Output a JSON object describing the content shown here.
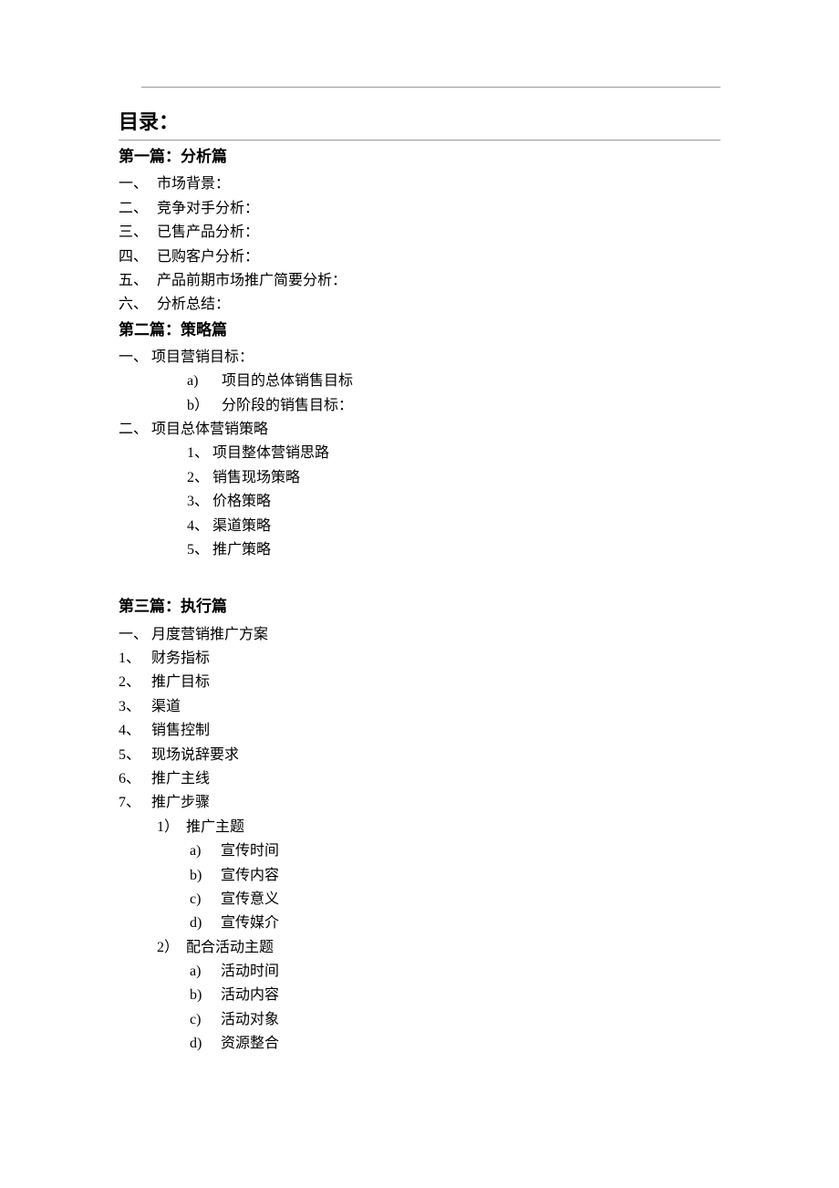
{
  "toc_title": "目录：",
  "section1": {
    "heading": "第一篇：分析篇",
    "items": [
      {
        "num": "一、",
        "text": "市场背景："
      },
      {
        "num": "二、",
        "text": "竞争对手分析："
      },
      {
        "num": "三、",
        "text": "已售产品分析："
      },
      {
        "num": "四、",
        "text": "已购客户分析："
      },
      {
        "num": "五、",
        "text": "产品前期市场推广简要分析："
      },
      {
        "num": "六、",
        "text": "分析总结："
      }
    ]
  },
  "section2": {
    "heading": "第二篇：策略篇",
    "item1": {
      "num": "一、",
      "text": "项目营销目标："
    },
    "item1_sub": [
      {
        "mark": "a)",
        "text": "项目的总体销售目标"
      },
      {
        "mark": "b）",
        "text": "分阶段的销售目标："
      }
    ],
    "item2": {
      "num": "二、",
      "text": "项目总体营销策略"
    },
    "item2_sub": [
      {
        "mark": "1、",
        "text": "项目整体营销思路"
      },
      {
        "mark": "2、",
        "text": "销售现场策略"
      },
      {
        "mark": "3、",
        "text": "价格策略"
      },
      {
        "mark": "4、",
        "text": "渠道策略"
      },
      {
        "mark": "5、",
        "text": "推广策略"
      }
    ]
  },
  "section3": {
    "heading": "第三篇：执行篇",
    "item0": {
      "num": "一、",
      "text": "月度营销推广方案"
    },
    "items": [
      {
        "num": "1、",
        "text": "财务指标"
      },
      {
        "num": "2、",
        "text": "推广目标"
      },
      {
        "num": "3、",
        "text": "渠道"
      },
      {
        "num": "4、",
        "text": "销售控制"
      },
      {
        "num": "5、",
        "text": "现场说辞要求"
      },
      {
        "num": "6、",
        "text": "推广主线"
      },
      {
        "num": "7、",
        "text": "推广步骤"
      }
    ],
    "sub1": {
      "mark": "1）",
      "text": "推广主题"
    },
    "sub1_items": [
      {
        "mark": "a)",
        "text": "宣传时间"
      },
      {
        "mark": "b)",
        "text": "宣传内容"
      },
      {
        "mark": "c)",
        "text": "宣传意义"
      },
      {
        "mark": "d)",
        "text": "宣传媒介"
      }
    ],
    "sub2": {
      "mark": "2）",
      "text": "配合活动主题"
    },
    "sub2_items": [
      {
        "mark": "a)",
        "text": "活动时间"
      },
      {
        "mark": "b)",
        "text": "活动内容"
      },
      {
        "mark": "c)",
        "text": "活动对象"
      },
      {
        "mark": "d)",
        "text": "资源整合"
      }
    ]
  }
}
